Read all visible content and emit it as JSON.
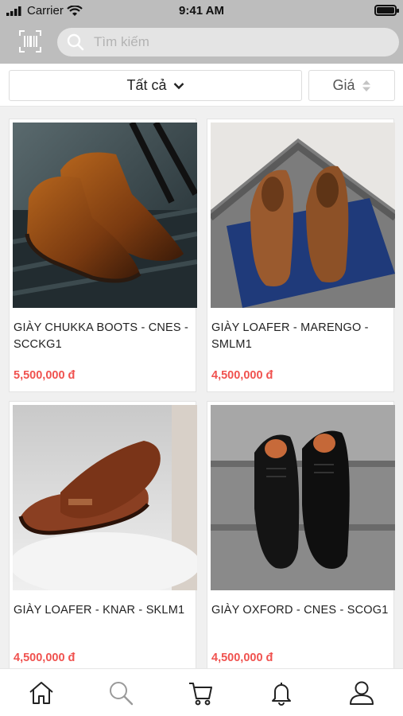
{
  "status_bar": {
    "carrier": "Carrier",
    "time": "9:41 AM"
  },
  "header": {
    "search_placeholder": "Tìm kiếm",
    "barcode_icon": "barcode-scan-icon"
  },
  "filters": {
    "category_label": "Tất cả",
    "price_label": "Giá"
  },
  "products": [
    {
      "name": "GIÀY CHUKKA BOOTS - CNES - SCCKG1",
      "price": "5,500,000 đ"
    },
    {
      "name": "GIÀY LOAFER - MARENGO - SMLM1",
      "price": "4,500,000 đ"
    },
    {
      "name": "GIÀY LOAFER - KNAR - SKLM1",
      "price": "4,500,000 đ"
    },
    {
      "name": "GIÀY OXFORD - CNES - SCOG1",
      "price": "4,500,000 đ"
    }
  ],
  "tabbar": {
    "items": [
      "home-icon",
      "search-icon",
      "cart-icon",
      "bell-icon",
      "user-icon"
    ],
    "active": "home-icon"
  },
  "colors": {
    "header_bg": "#bdbdbd",
    "price": "#f0524f",
    "tab_inactive": "#9a9a9a",
    "tab_active": "#222222"
  }
}
